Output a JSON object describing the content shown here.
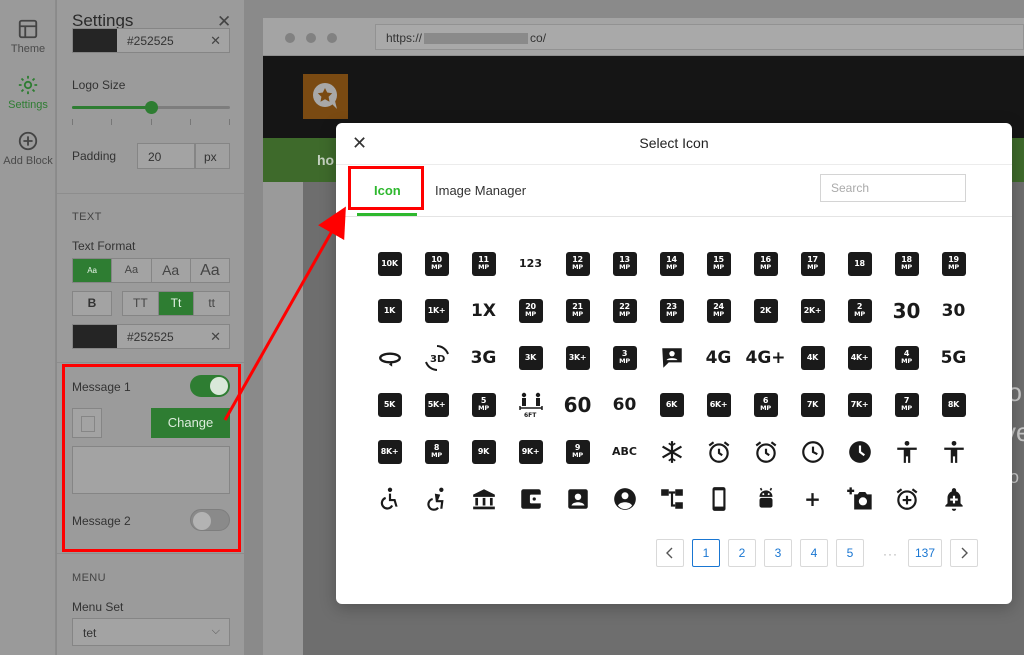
{
  "rail": {
    "items": [
      {
        "label": "Theme",
        "icon": "layout-icon"
      },
      {
        "label": "Settings",
        "icon": "gear-icon"
      },
      {
        "label": "Add Block",
        "icon": "plus-circle-icon"
      }
    ]
  },
  "panel": {
    "title": "Settings",
    "top_color_value": "#252525",
    "logo_size_label": "Logo Size",
    "logo_size_fraction": 0.5,
    "padding_label": "Padding",
    "padding_value": "20",
    "padding_unit": "px",
    "text_section": "TEXT",
    "text_format_label": "Text Format",
    "size_options": [
      "Aa",
      "Aa",
      "Aa",
      "Aa"
    ],
    "bold_label": "B",
    "case_options": [
      "TT",
      "Tt",
      "tt"
    ],
    "text_color_value": "#252525",
    "message1_label": "Message 1",
    "message1_on": true,
    "change_label": "Change",
    "message2_label": "Message 2",
    "message2_on": false,
    "menu_section": "MENU",
    "menu_set_label": "Menu Set",
    "menu_set_value": "tet"
  },
  "browser": {
    "url_prefix": "https://",
    "url_suffix": "co/",
    "nav_text": "ho",
    "hero_lines": [
      "no",
      "ve",
      "o"
    ]
  },
  "modal": {
    "title": "Select Icon",
    "tabs": [
      "Icon",
      "Image Manager"
    ],
    "search_placeholder": "Search",
    "icons": [
      {
        "t": "chip",
        "a": "10K"
      },
      {
        "t": "chip",
        "a": "10",
        "b": "MP"
      },
      {
        "t": "chip",
        "a": "11",
        "b": "MP"
      },
      {
        "t": "glyph",
        "a": "123",
        "cls": "small"
      },
      {
        "t": "chip",
        "a": "12",
        "b": "MP"
      },
      {
        "t": "chip",
        "a": "13",
        "b": "MP"
      },
      {
        "t": "chip",
        "a": "14",
        "b": "MP"
      },
      {
        "t": "chip",
        "a": "15",
        "b": "MP"
      },
      {
        "t": "chip",
        "a": "16",
        "b": "MP"
      },
      {
        "t": "chip",
        "a": "17",
        "b": "MP"
      },
      {
        "t": "chip",
        "a": "18"
      },
      {
        "t": "chip",
        "a": "18",
        "b": "MP"
      },
      {
        "t": "chip",
        "a": "19",
        "b": "MP"
      },
      {
        "t": "chip",
        "a": "1K"
      },
      {
        "t": "chip",
        "a": "1K+"
      },
      {
        "t": "glyph",
        "a": "1X",
        "cls": "mid"
      },
      {
        "t": "chip",
        "a": "20",
        "b": "MP"
      },
      {
        "t": "chip",
        "a": "21",
        "b": "MP"
      },
      {
        "t": "chip",
        "a": "22",
        "b": "MP"
      },
      {
        "t": "chip",
        "a": "23",
        "b": "MP"
      },
      {
        "t": "chip",
        "a": "24",
        "b": "MP"
      },
      {
        "t": "chip",
        "a": "2K"
      },
      {
        "t": "chip",
        "a": "2K+"
      },
      {
        "t": "chip",
        "a": "2",
        "b": "MP"
      },
      {
        "t": "glyph",
        "a": "30"
      },
      {
        "t": "glyph",
        "a": "30",
        "cls": "mid"
      },
      {
        "t": "svg",
        "a": "360"
      },
      {
        "t": "svg",
        "a": "3d"
      },
      {
        "t": "glyph",
        "a": "3G",
        "cls": "mid"
      },
      {
        "t": "chip",
        "a": "3K"
      },
      {
        "t": "chip",
        "a": "3K+"
      },
      {
        "t": "chip",
        "a": "3",
        "b": "MP"
      },
      {
        "t": "svg",
        "a": "account-box"
      },
      {
        "t": "glyph",
        "a": "4G",
        "cls": "mid"
      },
      {
        "t": "glyph",
        "a": "4G+",
        "cls": "mid"
      },
      {
        "t": "chip",
        "a": "4K"
      },
      {
        "t": "chip",
        "a": "4K+"
      },
      {
        "t": "chip",
        "a": "4",
        "b": "MP"
      },
      {
        "t": "glyph",
        "a": "5G",
        "cls": "mid"
      },
      {
        "t": "chip",
        "a": "5K"
      },
      {
        "t": "chip",
        "a": "5K+"
      },
      {
        "t": "chip",
        "a": "5",
        "b": "MP"
      },
      {
        "t": "svg",
        "a": "6ft"
      },
      {
        "t": "glyph",
        "a": "60"
      },
      {
        "t": "glyph",
        "a": "60",
        "cls": "mid"
      },
      {
        "t": "chip",
        "a": "6K"
      },
      {
        "t": "chip",
        "a": "6K+"
      },
      {
        "t": "chip",
        "a": "6",
        "b": "MP"
      },
      {
        "t": "chip",
        "a": "7K"
      },
      {
        "t": "chip",
        "a": "7K+"
      },
      {
        "t": "chip",
        "a": "7",
        "b": "MP"
      },
      {
        "t": "chip",
        "a": "8K"
      },
      {
        "t": "chip",
        "a": "8K+"
      },
      {
        "t": "chip",
        "a": "8",
        "b": "MP"
      },
      {
        "t": "chip",
        "a": "9K"
      },
      {
        "t": "chip",
        "a": "9K+"
      },
      {
        "t": "chip",
        "a": "9",
        "b": "MP"
      },
      {
        "t": "glyph",
        "a": "ABC",
        "cls": "small"
      },
      {
        "t": "svg",
        "a": "snowflake"
      },
      {
        "t": "svg",
        "a": "alarm"
      },
      {
        "t": "svg",
        "a": "alarm"
      },
      {
        "t": "svg",
        "a": "clock"
      },
      {
        "t": "svg",
        "a": "clock-filled"
      },
      {
        "t": "svg",
        "a": "accessibility"
      },
      {
        "t": "svg",
        "a": "accessibility"
      },
      {
        "t": "svg",
        "a": "wheelchair"
      },
      {
        "t": "svg",
        "a": "wheelchair-move"
      },
      {
        "t": "svg",
        "a": "bank"
      },
      {
        "t": "svg",
        "a": "wallet"
      },
      {
        "t": "svg",
        "a": "portrait"
      },
      {
        "t": "svg",
        "a": "account-circle"
      },
      {
        "t": "svg",
        "a": "tree"
      },
      {
        "t": "svg",
        "a": "phone"
      },
      {
        "t": "svg",
        "a": "android"
      },
      {
        "t": "glyph",
        "a": "+"
      },
      {
        "t": "svg",
        "a": "add-camera"
      },
      {
        "t": "svg",
        "a": "add-alarm"
      },
      {
        "t": "svg",
        "a": "add-alert"
      }
    ],
    "pages": [
      "1",
      "2",
      "3",
      "4",
      "5",
      "137"
    ],
    "active_page": "1",
    "ellipsis": "···",
    "prev_icon": "chevron-left-icon",
    "next_icon": "chevron-right-icon"
  },
  "colors": {
    "accent_green": "#2eb82e",
    "annotation_red": "#ff0000",
    "page_blue": "#1976d2"
  }
}
